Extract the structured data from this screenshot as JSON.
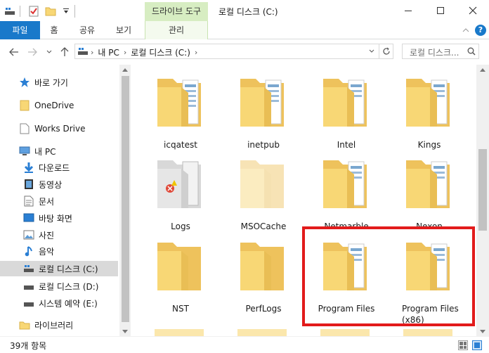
{
  "titlebar": {
    "tools_label": "드라이브 도구",
    "title": "로컬 디스크 (C:)",
    "minimize_icon": "minimize-icon",
    "maximize_icon": "maximize-icon",
    "close_icon": "close-icon"
  },
  "ribbon": {
    "file_tab": "파일",
    "tabs": [
      "홈",
      "공유",
      "보기"
    ],
    "manage_tab": "관리"
  },
  "address": {
    "crumbs": [
      "내 PC",
      "로컬 디스크 (C:)"
    ],
    "search_placeholder": "로컬 디스크..."
  },
  "nav": {
    "items": [
      {
        "label": "바로 가기",
        "icon": "star-icon"
      },
      {
        "label": "OneDrive",
        "icon": "folder-icon"
      },
      {
        "label": "Works Drive",
        "icon": "document-icon"
      },
      {
        "label": "내 PC",
        "icon": "computer-icon"
      },
      {
        "label": "다운로드",
        "icon": "download-icon"
      },
      {
        "label": "동영상",
        "icon": "video-icon"
      },
      {
        "label": "문서",
        "icon": "documents-icon"
      },
      {
        "label": "바탕 화면",
        "icon": "desktop-icon"
      },
      {
        "label": "사진",
        "icon": "pictures-icon"
      },
      {
        "label": "음악",
        "icon": "music-icon"
      },
      {
        "label": "로컬 디스크 (C:)",
        "icon": "drive-icon"
      },
      {
        "label": "로컬 디스크 (D:)",
        "icon": "drive-icon"
      },
      {
        "label": "시스템 예약 (E:)",
        "icon": "drive-icon"
      },
      {
        "label": "라이브러리",
        "icon": "library-icon"
      }
    ]
  },
  "folders": [
    {
      "label": "icqatest"
    },
    {
      "label": "inetpub"
    },
    {
      "label": "Intel"
    },
    {
      "label": "Kings"
    },
    {
      "label": "Logs"
    },
    {
      "label": "MSOCache"
    },
    {
      "label": "Netmarble"
    },
    {
      "label": "Nexon"
    },
    {
      "label": "NST"
    },
    {
      "label": "PerfLogs"
    },
    {
      "label": "Program Files"
    },
    {
      "label": "Program Files (x86)"
    }
  ],
  "status": {
    "item_count": "39개 항목"
  },
  "colors": {
    "accent": "#1979ca",
    "tools_bg": "#d7edc2",
    "highlight": "#e21b1b",
    "folder": "#f8d775"
  }
}
